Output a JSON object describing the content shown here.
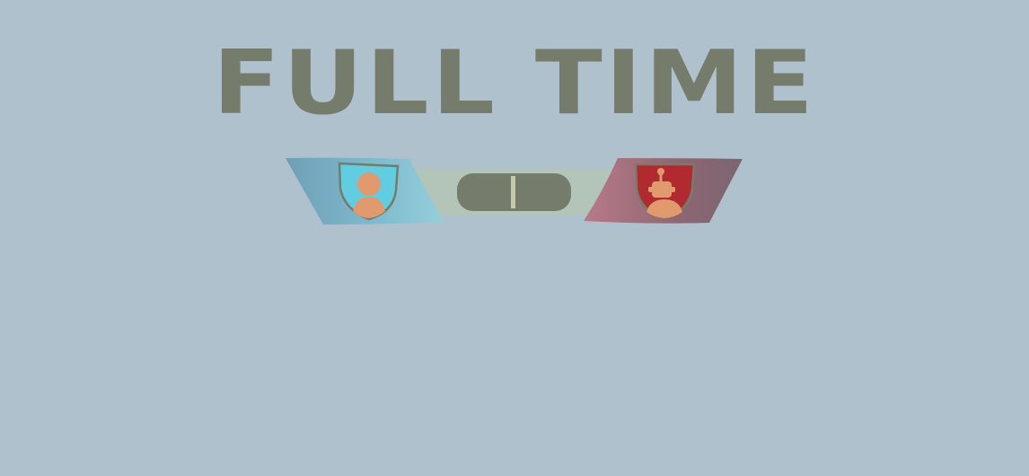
{
  "title": "FULL TIME",
  "scoreboard": {
    "home_team": {
      "crest_icon": "person-shield-icon",
      "crest_color": "#62cde0",
      "banner_color": "#7fb9cf"
    },
    "away_team": {
      "crest_icon": "robot-shield-icon",
      "crest_color": "#b02a2f",
      "banner_color": "#a36f7c"
    },
    "score_pill": {
      "color": "#767c6b",
      "divider_color": "#c6c9a8"
    }
  },
  "colors": {
    "background": "#b0c1ce",
    "title": "#767c6b",
    "figure": "#e09a6e",
    "center_band": "#b3c4b8"
  }
}
